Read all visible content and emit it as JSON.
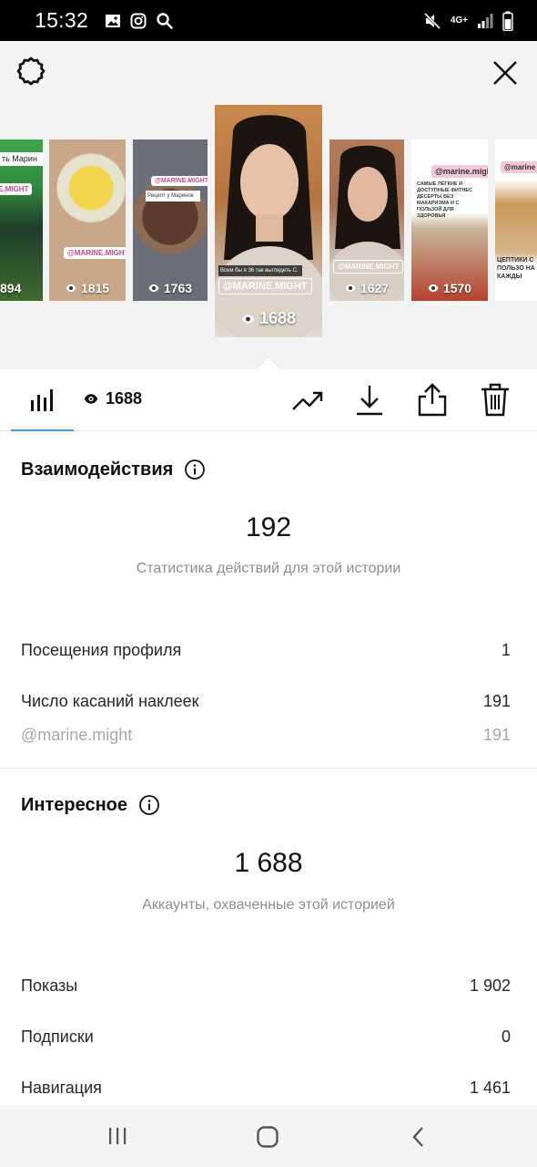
{
  "status_bar": {
    "time": "15:32",
    "network": "4G+",
    "icons_left": [
      "gallery-icon",
      "instagram-icon",
      "search-icon"
    ],
    "icons_right": [
      "mute-icon",
      "signal-icon",
      "battery-icon"
    ]
  },
  "header": {
    "settings_icon": "gear-icon",
    "close_icon": "close-icon"
  },
  "stories": [
    {
      "views": "894",
      "sticker": "@MARINE.MIGHT",
      "caption": "ть Марин"
    },
    {
      "views": "1815",
      "sticker": "@MARINE.MIGHT"
    },
    {
      "views": "1763",
      "sticker": "@MARINE.MIGHT",
      "caption": "Рецепт у Маринок"
    },
    {
      "views": "1688",
      "sticker": "@MARINE.MIGHT",
      "caption": "Всем бы я 36 так выглядеть С.",
      "selected": true
    },
    {
      "views": "1627",
      "sticker": "@MARINE.MIGHT"
    },
    {
      "views": "1570",
      "sticker": "@marine.might",
      "caption": "САМЫЕ ЛЁГКИЕ И ДОСТУПНЫЕ ФИТНЕС ДЕСЕРТЫ БЕЗ МАКАРИЗМА И С ПОЛЬЗОЙ ДЛЯ ЗДОРОВЬЯ"
    },
    {
      "views": "",
      "sticker": "@marine",
      "caption": "ЦЕПТИКИ С ПОЛЬЗО НА КАЖДЫ"
    }
  ],
  "toolbar": {
    "views": "1688",
    "actions": [
      "insights-icon",
      "download-icon",
      "share-icon",
      "delete-icon"
    ]
  },
  "interactions": {
    "title": "Взаимодействия",
    "total": "192",
    "caption": "Статистика действий для этой истории",
    "rows": [
      {
        "label": "Посещения профиля",
        "value": "1"
      },
      {
        "label": "Число касаний наклеек",
        "value": "191"
      },
      {
        "label": "@marine.might",
        "value": "191"
      }
    ]
  },
  "discovery": {
    "title": "Интересное",
    "total": "1 688",
    "caption": "Аккаунты, охваченные этой историей",
    "rows": [
      {
        "label": "Показы",
        "value": "1 902"
      },
      {
        "label": "Подписки",
        "value": "0"
      },
      {
        "label": "Навигация",
        "value": "1 461"
      }
    ]
  },
  "nav_bar": {
    "buttons": [
      "recents-icon",
      "home-icon",
      "back-icon"
    ]
  }
}
